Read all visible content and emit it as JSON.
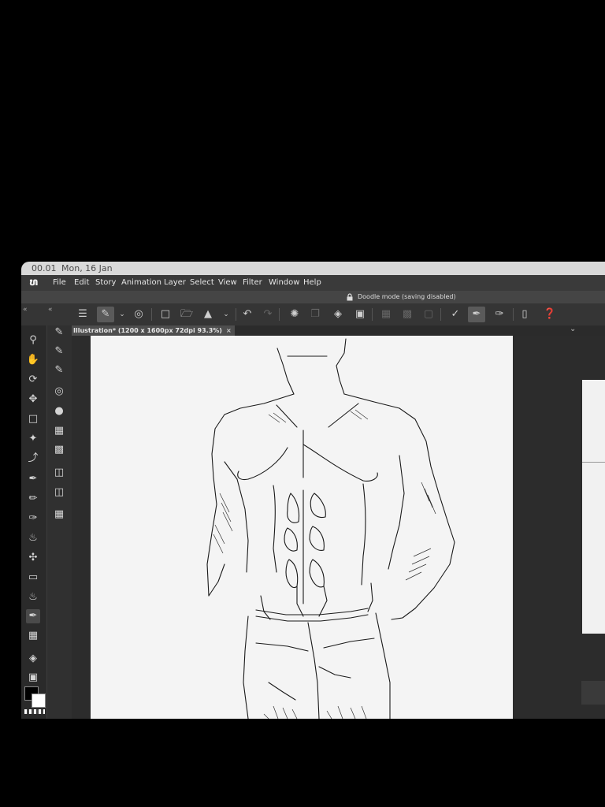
{
  "status": {
    "time": "00.01",
    "date": "Mon, 16 Jan"
  },
  "menu": [
    "File",
    "Edit",
    "Story",
    "Animation",
    "Layer",
    "Select",
    "View",
    "Filter",
    "Window",
    "Help"
  ],
  "doodle": "Doodle mode (saving disabled)",
  "tab": {
    "title": "Illustration* (1200 x 1600px 72dpi 93.3%)",
    "close": "×"
  },
  "tools": [
    "zoom-icon",
    "hand-icon",
    "rotate-icon",
    "move-icon",
    "selection-icon",
    "magic-wand-icon",
    "eyedropper-icon",
    "pen-icon",
    "pencil-icon",
    "brush-icon",
    "airbrush-icon",
    "decoration-icon",
    "eraser-icon",
    "blend-icon",
    "ruler-pen-icon",
    "frame-icon",
    "fill-icon",
    "gradient-icon"
  ],
  "colors": {
    "foreground": "#000000",
    "background": "#ffffff"
  }
}
